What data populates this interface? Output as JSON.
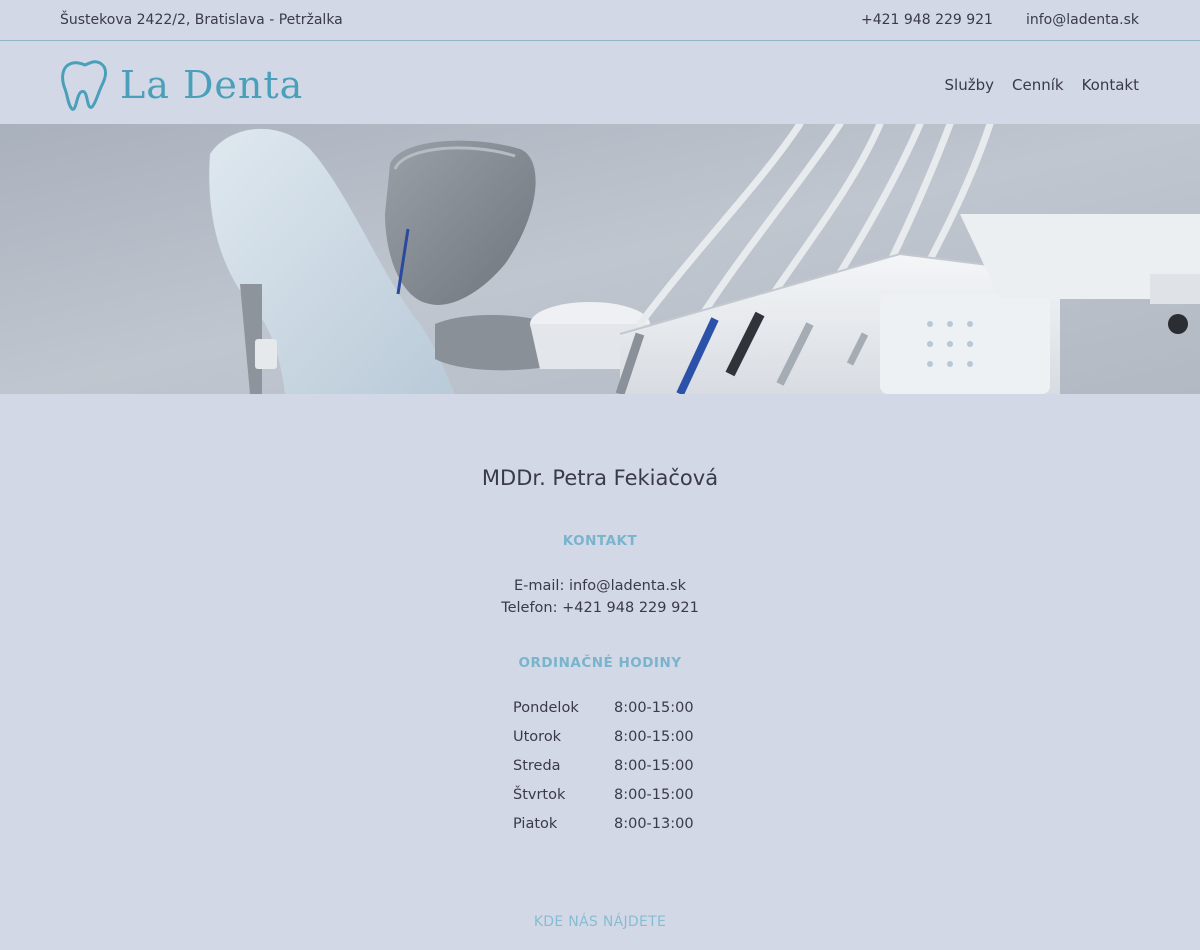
{
  "topbar": {
    "address": "Šustekova 2422/2, Bratislava - Petržalka",
    "phone": "+421 948 229 921",
    "email": "info@ladenta.sk"
  },
  "header": {
    "logo_text": "La Denta",
    "nav": [
      "Služby",
      "Cenník",
      "Kontakt"
    ]
  },
  "colors": {
    "background": "#d3d8e6",
    "accent": "#4a9fba",
    "section_title": "#78b4cc",
    "text": "#3a3a48"
  },
  "main": {
    "doctor_name": "MDDr. Petra Fekiačová",
    "contact_title": "KONTAKT",
    "contact_email_line": "E-mail: info@ladenta.sk",
    "contact_phone_line": "Telefon: +421 948 229 921",
    "hours_title": "ORDINAČNÉ HODINY",
    "hours": [
      {
        "day": "Pondelok",
        "time": "8:00-15:00"
      },
      {
        "day": "Utorok",
        "time": "8:00-15:00"
      },
      {
        "day": "Streda",
        "time": "8:00-15:00"
      },
      {
        "day": "Štvrtok",
        "time": "8:00-15:00"
      },
      {
        "day": "Piatok",
        "time": "8:00-13:00"
      }
    ],
    "find_us": "KDE NÁS NÁJDETE"
  },
  "icons": {
    "logo": "tooth-icon"
  }
}
